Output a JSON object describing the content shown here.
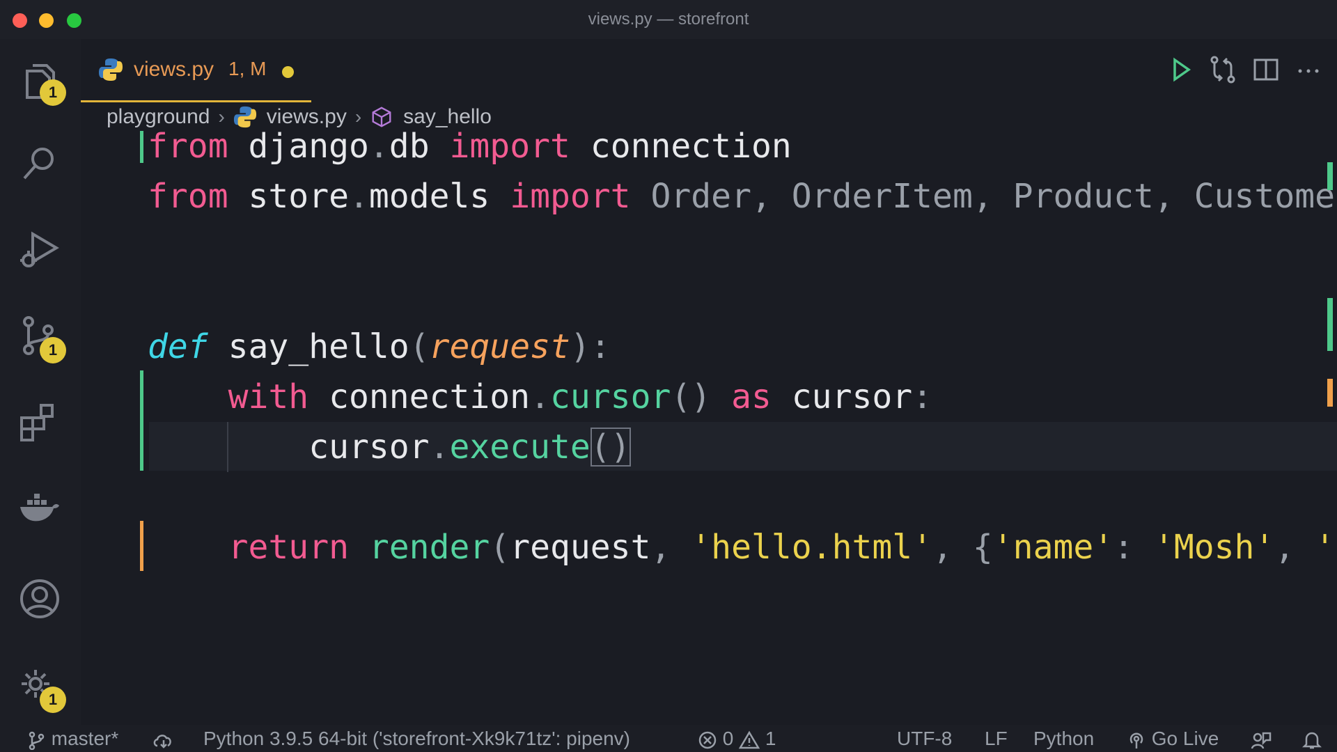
{
  "window": {
    "title": "views.py — storefront"
  },
  "activity_bar": {
    "explorer_badge": "1",
    "source_control_badge": "1",
    "settings_badge": "1"
  },
  "tab": {
    "filename": "views.py",
    "status": "1, M"
  },
  "breadcrumb": {
    "folder": "playground",
    "file": "views.py",
    "symbol": "say_hello"
  },
  "code": {
    "line1": {
      "kw_from": "from",
      "module": " django",
      "dot": ".",
      "module2": "db ",
      "kw_import": "import",
      "rest": " connection"
    },
    "line2": {
      "kw_from": "from",
      "module": " store",
      "dot": ".",
      "module2": "models ",
      "kw_import": "import",
      "rest": " Order, OrderItem, Product, Custome"
    },
    "line3": {
      "kw_def": "def",
      "name": " say_hello",
      "open": "(",
      "param": "request",
      "close": "):"
    },
    "line4": {
      "indent": "    ",
      "kw_with": "with",
      "obj": " connection",
      "dot": ".",
      "method": "cursor",
      "parens": "()",
      "kw_as": " as",
      "var": " cursor",
      "colon": ":"
    },
    "line5": {
      "indent": "        ",
      "obj": "cursor",
      "dot": ".",
      "method": "execute",
      "parens": "()"
    },
    "line6": {
      "indent": "    ",
      "kw_return": "return",
      "fn": " render",
      "open": "(",
      "arg": "request",
      "comma1": ", ",
      "s1": "'hello.html'",
      "comma2": ", ",
      "brace": "{",
      "s2": "'name'",
      "colon": ": ",
      "s3": "'Mosh'",
      "comma3": ", ",
      "s4": "'"
    }
  },
  "status_bar": {
    "branch": "master*",
    "interpreter": "Python 3.9.5 64-bit ('storefront-Xk9k71tz': pipenv)",
    "errors": "0",
    "warnings": "1",
    "encoding": "UTF-8",
    "eol": "LF",
    "language": "Python",
    "go_live": "Go Live"
  },
  "colors": {
    "accent_tab": "#e2b53a",
    "added_gutter": "#4ec98a",
    "modified_gutter": "#f0a04b",
    "badge": "#e2c83a"
  }
}
